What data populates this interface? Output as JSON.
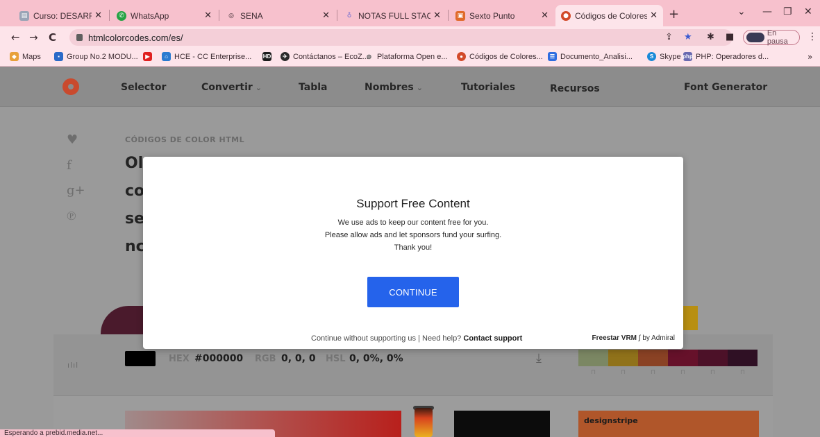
{
  "browser": {
    "tabs": [
      {
        "label": "Curso: DESARROLLO W",
        "favicon": "course-icon"
      },
      {
        "label": "WhatsApp",
        "favicon": "whatsapp-icon"
      },
      {
        "label": "SENA",
        "favicon": "sena-icon"
      },
      {
        "label": "NOTAS FULL STACK TA",
        "favicon": "notas-icon"
      },
      {
        "label": "Sexto Punto",
        "favicon": "sexto-icon"
      },
      {
        "label": "Códigos de Colores H",
        "favicon": "htmlcolorcodes-icon",
        "active": true
      }
    ],
    "new_tab_symbol": "+",
    "url": "htmlcolorcodes.com/es/",
    "profile_status": "En pausa",
    "bookmarks": [
      {
        "label": "Maps",
        "icon": "maps-icon"
      },
      {
        "label": "Group No.2 MODU...",
        "icon": "group-icon"
      },
      {
        "label": "",
        "icon": "youtube-icon"
      },
      {
        "label": "HCE - CC Enterprise...",
        "icon": "hce-icon"
      },
      {
        "label": "",
        "icon": "hd-icon"
      },
      {
        "label": "Contáctanos – EcoZ...",
        "icon": "contact-icon"
      },
      {
        "label": "Plataforma Open e...",
        "icon": "plataforma-icon"
      },
      {
        "label": "Códigos de Colores...",
        "icon": "htmlcolorcodes-icon"
      },
      {
        "label": "Documento_Analisi...",
        "icon": "docs-icon"
      },
      {
        "label": "Skype",
        "icon": "skype-icon"
      },
      {
        "label": "PHP: Operadores d...",
        "icon": "php-icon"
      }
    ],
    "status_text": "Esperando a prebid.media.net..."
  },
  "site": {
    "nav": [
      {
        "label": "Selector",
        "dropdown": false
      },
      {
        "label": "Convertir",
        "dropdown": true
      },
      {
        "label": "Tabla",
        "dropdown": false
      },
      {
        "label": "Nombres",
        "dropdown": true
      },
      {
        "label": "Tutoriales",
        "dropdown": false
      },
      {
        "label": "Recursos",
        "dropdown": false
      },
      {
        "label": "Font Generator",
        "dropdown": false
      }
    ],
    "kicker": "CÓDIGOS DE COLOR HTML",
    "headline_fragments": [
      "Ol",
      "co",
      "se",
      "nc"
    ],
    "color_values": {
      "hex_label": "HEX",
      "hex": "#000000",
      "rgb_label": "RGB",
      "rgb": "0, 0, 0",
      "hsl_label": "HSL",
      "hsl": "0, 0%, 0%"
    },
    "palette": [
      "#c6d9a0",
      "#e8b82a",
      "#df6a3a",
      "#a41b43",
      "#7a1c40",
      "#4c1a3a"
    ],
    "ad_brand": "designstripe"
  },
  "modal": {
    "title": "Support Free Content",
    "lines": [
      "We use ads to keep our content free for you.",
      "Please allow ads and let sponsors fund your surfing.",
      "Thank you!"
    ],
    "button_label": "CONTINUE",
    "footer_text": "Continue without supporting us",
    "footer_sep": "|",
    "help_text": "Need help?",
    "help_link": "Contact support",
    "brand_text": "Freestar VRM",
    "brand_by": "by Admiral"
  }
}
